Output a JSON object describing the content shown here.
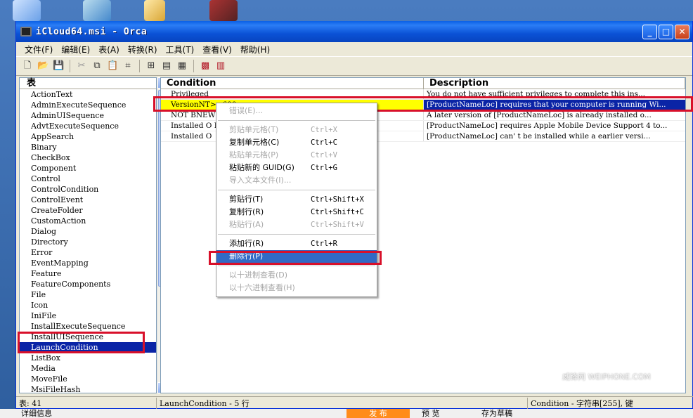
{
  "window": {
    "title": "iCloud64.msi - Orca",
    "min_glyph": "_",
    "max_glyph": "□",
    "close_glyph": "✕"
  },
  "menu": [
    "文件(F)",
    "编辑(E)",
    "表(A)",
    "转换(R)",
    "工具(T)",
    "查看(V)",
    "帮助(H)"
  ],
  "left_panel": {
    "header": "表",
    "selected": "LaunchCondition",
    "tables": [
      "ActionText",
      "AdminExecuteSequence",
      "AdminUISequence",
      "AdvtExecuteSequence",
      "AppSearch",
      "Binary",
      "CheckBox",
      "Component",
      "Control",
      "ControlCondition",
      "ControlEvent",
      "CreateFolder",
      "CustomAction",
      "Dialog",
      "Directory",
      "Error",
      "EventMapping",
      "Feature",
      "FeatureComponents",
      "File",
      "Icon",
      "IniFile",
      "InstallExecuteSequence",
      "InstallUISequence",
      "LaunchCondition",
      "ListBox",
      "Media",
      "MoveFile",
      "MsiFileHash"
    ]
  },
  "grid": {
    "col_condition": "Condition",
    "col_description": "Description",
    "rows": [
      {
        "condition": "Privileged",
        "description": "You do not have sufficient privileges to complete this ins..."
      },
      {
        "condition": "VersionNT>=600",
        "description": "[ProductNameLoc] requires that your computer is running Wi..."
      },
      {
        "condition": "NOT BNEWERP",
        "description": "A later version of [ProductNameLoc] is already installed o..."
      },
      {
        "condition": "Installed O                                        EST OR ...",
        "description": "[ProductNameLoc] requires Apple Mobile Device Support 4 to..."
      },
      {
        "condition": "Installed O",
        "description": "[ProductNameLoc] can' t be installed while a earlier versi..."
      }
    ]
  },
  "context_menu": {
    "items": [
      {
        "label": "错误(E)...",
        "shortcut": "",
        "disabled": true
      },
      {
        "sep": true
      },
      {
        "label": "剪贴单元格(T)",
        "shortcut": "Ctrl+X",
        "disabled": true
      },
      {
        "label": "复制单元格(C)",
        "shortcut": "Ctrl+C",
        "disabled": false
      },
      {
        "label": "粘贴单元格(P)",
        "shortcut": "Ctrl+V",
        "disabled": true
      },
      {
        "label": "粘贴新的 GUID(G)",
        "shortcut": "Ctrl+G",
        "disabled": false
      },
      {
        "label": "导入文本文件(I)...",
        "shortcut": "",
        "disabled": true
      },
      {
        "sep": true
      },
      {
        "label": "剪贴行(T)",
        "shortcut": "Ctrl+Shift+X",
        "disabled": false
      },
      {
        "label": "复制行(R)",
        "shortcut": "Ctrl+Shift+C",
        "disabled": false
      },
      {
        "label": "粘贴行(A)",
        "shortcut": "Ctrl+Shift+V",
        "disabled": true
      },
      {
        "sep": true
      },
      {
        "label": "添加行(R)",
        "shortcut": "Ctrl+R",
        "disabled": false
      },
      {
        "label": "删除行(P)",
        "shortcut": "",
        "disabled": false,
        "active": true
      },
      {
        "sep": true
      },
      {
        "label": "以十进制查看(D)",
        "shortcut": "",
        "disabled": true
      },
      {
        "label": "以十六进制查看(H)",
        "shortcut": "",
        "disabled": true
      }
    ]
  },
  "status": {
    "tables_count": "表: 41",
    "table_info": "LaunchCondition - 5 行",
    "column_info": "Condition - 字符串[255], 键"
  },
  "watermark": "威锋网 WEIPHONE.COM",
  "background_page": {
    "left_text": "详细信息",
    "publish": "发 布",
    "preview": "预 览",
    "save_draft": "存为草稿"
  }
}
